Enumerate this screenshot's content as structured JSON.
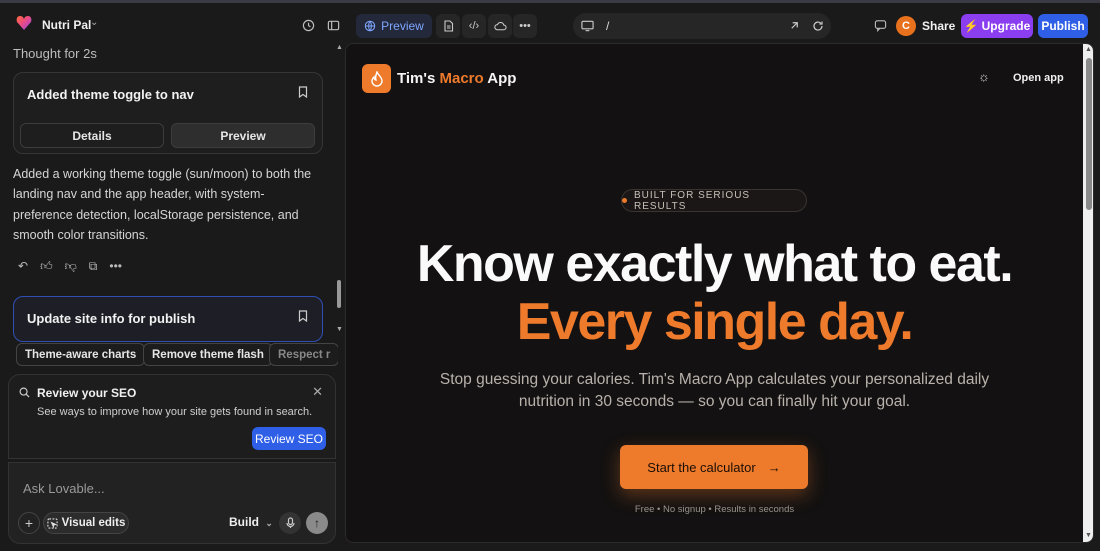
{
  "header": {
    "project_name": "Nutri Pal",
    "preview_label": "Preview",
    "url_path": "/",
    "avatar_initial": "C",
    "share_label": "Share",
    "upgrade_label": "Upgrade",
    "publish_label": "Publish"
  },
  "chat": {
    "thought": "Thought for 2s",
    "card1": {
      "title": "Added theme toggle to nav",
      "details_label": "Details",
      "preview_label": "Preview"
    },
    "message": "Added a working theme toggle (sun/moon) to both the landing nav and the app header, with system-preference detection, localStorage persistence, and smooth color transitions.",
    "card2": {
      "title": "Update site info for publish"
    },
    "chips": [
      "Theme-aware charts",
      "Remove theme flash",
      "Respect r"
    ],
    "seo": {
      "title": "Review your SEO",
      "description": "See ways to improve how your site gets found in search.",
      "button": "Review SEO"
    },
    "composer": {
      "placeholder": "Ask Lovable...",
      "visual_edits": "Visual edits",
      "mode": "Build"
    }
  },
  "preview": {
    "app_name_1": "Tim's ",
    "app_name_2": "Macro",
    "app_name_3": " App",
    "open_app": "Open app",
    "badge": "BUILT FOR SERIOUS RESULTS",
    "headline_1": "Know exactly what to eat.",
    "headline_2": "Every single day.",
    "subtitle": "Stop guessing your calories. Tim's Macro App calculates your personalized daily nutrition in 30 seconds — so you can finally hit your goal.",
    "cta": "Start the calculator",
    "note": "Free • No signup • Results in seconds"
  },
  "colors": {
    "accent": "#ee7a2c",
    "upgrade": "#8b3df0",
    "publish": "#2f5fe6"
  }
}
